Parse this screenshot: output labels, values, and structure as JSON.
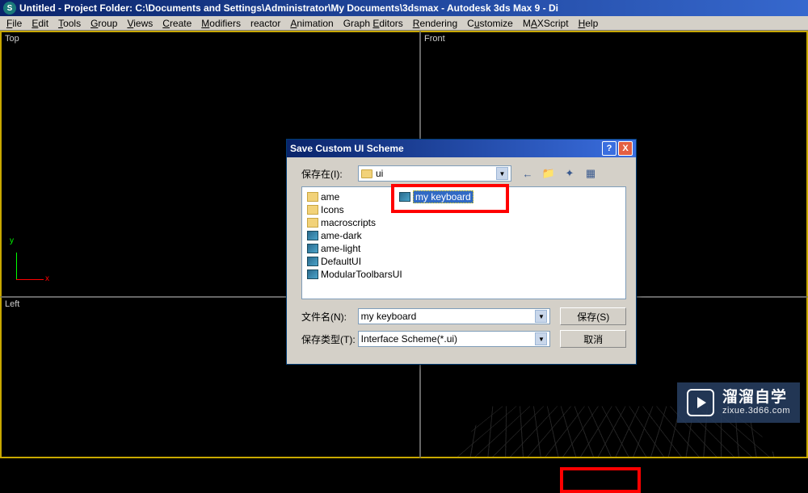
{
  "titlebar": {
    "text": "Untitled   - Project Folder: C:\\Documents and Settings\\Administrator\\My Documents\\3dsmax         - Autodesk 3ds Max 9     - Di"
  },
  "menu": {
    "items": [
      "File",
      "Edit",
      "Tools",
      "Group",
      "Views",
      "Create",
      "Modifiers",
      "reactor",
      "Animation",
      "Graph Editors",
      "Rendering",
      "Customize",
      "MAXScript",
      "Help"
    ]
  },
  "viewports": {
    "top": "Top",
    "front": "Front",
    "left": "Left",
    "persp": "",
    "axis_x": "x",
    "axis_y": "y"
  },
  "dialog": {
    "title": "Save Custom UI Scheme",
    "help": "?",
    "close": "X",
    "save_in_label": "保存在(I):",
    "save_in_value": "ui",
    "files": [
      {
        "icon": "folder",
        "name": "ame"
      },
      {
        "icon": "folder",
        "name": "Icons"
      },
      {
        "icon": "folder",
        "name": "macroscripts"
      },
      {
        "icon": "ui",
        "name": "ame-dark"
      },
      {
        "icon": "ui",
        "name": "ame-light"
      },
      {
        "icon": "ui",
        "name": "DefaultUI"
      },
      {
        "icon": "ui",
        "name": "ModularToolbarsUI"
      }
    ],
    "new_file": "my keyboard",
    "filename_label": "文件名(N):",
    "filename_value": "my keyboard",
    "filetype_label": "保存类型(T):",
    "filetype_value": "Interface Scheme(*.ui)",
    "save_btn": "保存(S)",
    "cancel_btn": "取消",
    "toolbar_icons": [
      "←",
      "📁",
      "✦",
      "▦"
    ]
  },
  "watermark": {
    "big": "溜溜自学",
    "small": "zixue.3d66.com"
  }
}
